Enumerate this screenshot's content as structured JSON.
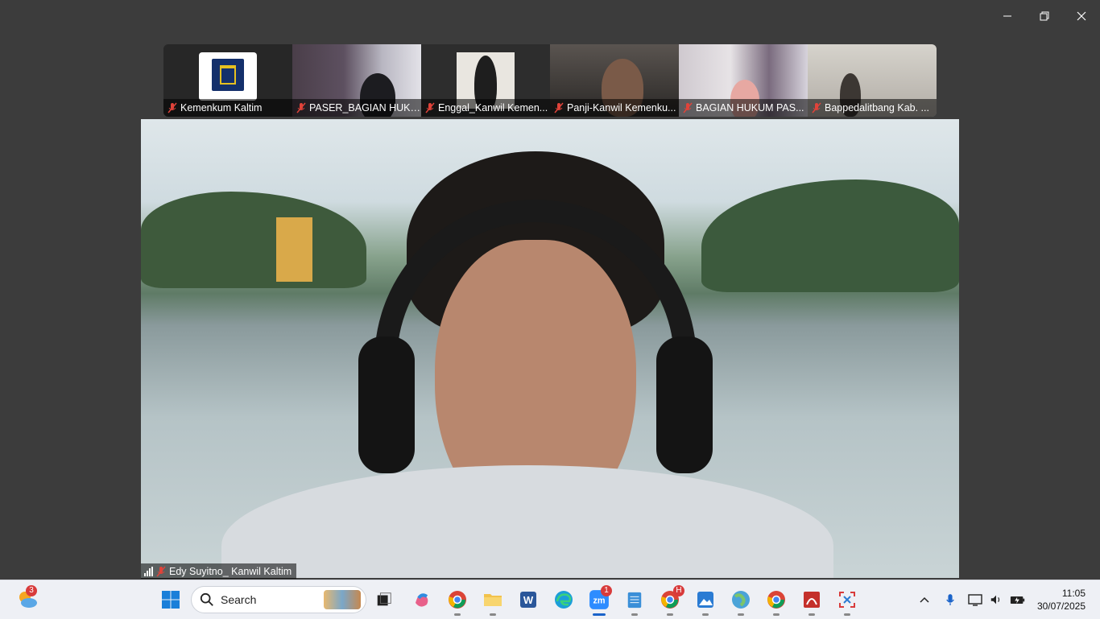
{
  "window": {
    "minimize_icon": "minimize-icon",
    "maximize_icon": "restore-icon",
    "close_icon": "close-icon"
  },
  "participants": [
    {
      "name": "Kemenkum Kaltim",
      "muted": true
    },
    {
      "name": "PASER_BAGIAN HUKU...",
      "muted": true
    },
    {
      "name": "Enggal_Kanwil Kemen...",
      "muted": true
    },
    {
      "name": "Panji-Kanwil Kemenku...",
      "muted": true
    },
    {
      "name": "BAGIAN HUKUM PAS...",
      "muted": true
    },
    {
      "name": "Bappedalitbang Kab. ...",
      "muted": true
    }
  ],
  "active_speaker": {
    "name": "Edy Suyitno_ Kanwil Kaltim",
    "muted": true,
    "signal_icon": "signal-bars-icon"
  },
  "taskbar": {
    "weather_badge": "3",
    "search_placeholder": "Search",
    "zoom_badge": "1",
    "chrome_badge": "H",
    "apps": [
      "windows-start-icon",
      "file-explorer-icon",
      "copilot-icon",
      "chrome-profile-icon",
      "folder-icon",
      "word-icon",
      "edge-icon",
      "zoom-icon",
      "notepad-icon",
      "chrome-icon",
      "photos-icon",
      "maps-icon",
      "chrome-alt-icon",
      "pdf-icon",
      "snipping-tool-icon"
    ],
    "clock_time": "11:05",
    "clock_date": "30/07/2025"
  },
  "colors": {
    "background": "#3c3c3c",
    "taskbar": "#eef0f5",
    "mute_red": "#e0433a",
    "badge_red": "#d83b3b",
    "accent": "#1a63c9"
  }
}
